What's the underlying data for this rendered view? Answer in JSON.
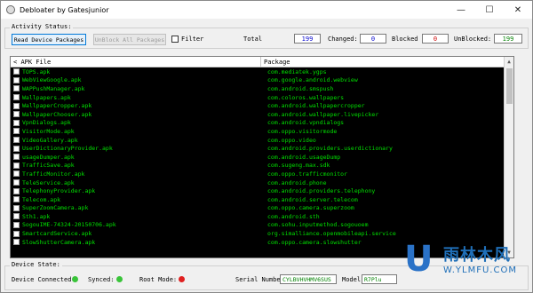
{
  "window": {
    "title": "Debloater by Gatesjunior",
    "minimize": "—",
    "maximize": "☐",
    "close": "✕"
  },
  "activity": {
    "label": "Activity Status:",
    "read_button": "Read Device Packages",
    "unblock_button": "UnBlock All Packages",
    "filter_label": "Filter",
    "total_label": "Total",
    "total_value": "199",
    "changed_label": "Changed:",
    "changed_value": "0",
    "blocked_label": "Blocked",
    "blocked_value": "0",
    "unblocked_label": "UnBlocked:",
    "unblocked_value": "199"
  },
  "list": {
    "headers": [
      "APK File",
      "Package"
    ],
    "rows": [
      {
        "file": "TOPS.apk",
        "pkg": "com.mediatek.ygps"
      },
      {
        "file": "WebViewGoogle.apk",
        "pkg": "com.google.android.webview"
      },
      {
        "file": "WAPPushManager.apk",
        "pkg": "com.android.smspush"
      },
      {
        "file": "Wallpapers.apk",
        "pkg": "com.coloros.wallpapers"
      },
      {
        "file": "WallpaperCropper.apk",
        "pkg": "com.android.wallpapercropper"
      },
      {
        "file": "WallpaperChooser.apk",
        "pkg": "com.android.wallpaper.livepicker"
      },
      {
        "file": "VpnDialogs.apk",
        "pkg": "com.android.vpndialogs"
      },
      {
        "file": "VisitorMode.apk",
        "pkg": "com.oppo.visitormode"
      },
      {
        "file": "VideoGallery.apk",
        "pkg": "com.oppo.video"
      },
      {
        "file": "UserDictionaryProvider.apk",
        "pkg": "com.android.providers.userdictionary"
      },
      {
        "file": "usageDumper.apk",
        "pkg": "com.android.usageDump"
      },
      {
        "file": "TrafficSave.apk",
        "pkg": "com.sugeng.max.sdk"
      },
      {
        "file": "TrafficMonitor.apk",
        "pkg": "com.oppo.trafficmonitor"
      },
      {
        "file": "TeleService.apk",
        "pkg": "com.android.phone"
      },
      {
        "file": "TelephonyProvider.apk",
        "pkg": "com.android.providers.telephony"
      },
      {
        "file": "Telecom.apk",
        "pkg": "com.android.server.telecom"
      },
      {
        "file": "SuperZoomCamera.apk",
        "pkg": "com.oppo.camera.superzoom"
      },
      {
        "file": "Sth1.apk",
        "pkg": "com.android.sth"
      },
      {
        "file": "SogouIME-74324-20150706.apk",
        "pkg": "com.sohu.inputmethod.sogouoem"
      },
      {
        "file": "SmartcardService.apk",
        "pkg": "org.simalliance.openmobileapi.service"
      },
      {
        "file": "SlowShutterCamera.apk",
        "pkg": "com.oppo.camera.slowshutter"
      }
    ]
  },
  "device": {
    "label": "Device State:",
    "connected_label": "Device Connected:",
    "synced_label": "Synced:",
    "root_label": "Root Mode:",
    "serial_label": "Serial Number:",
    "serial_value": "CYLBVHVHMV6SUS",
    "model_label": "Model",
    "model_value": "R7Plu",
    "connected_color": "#39c439",
    "synced_color": "#39c439",
    "root_color": "#e02020"
  },
  "watermark": {
    "letter": "U",
    "text": "雨林木风",
    "url": "W.YLMFU.COM"
  }
}
